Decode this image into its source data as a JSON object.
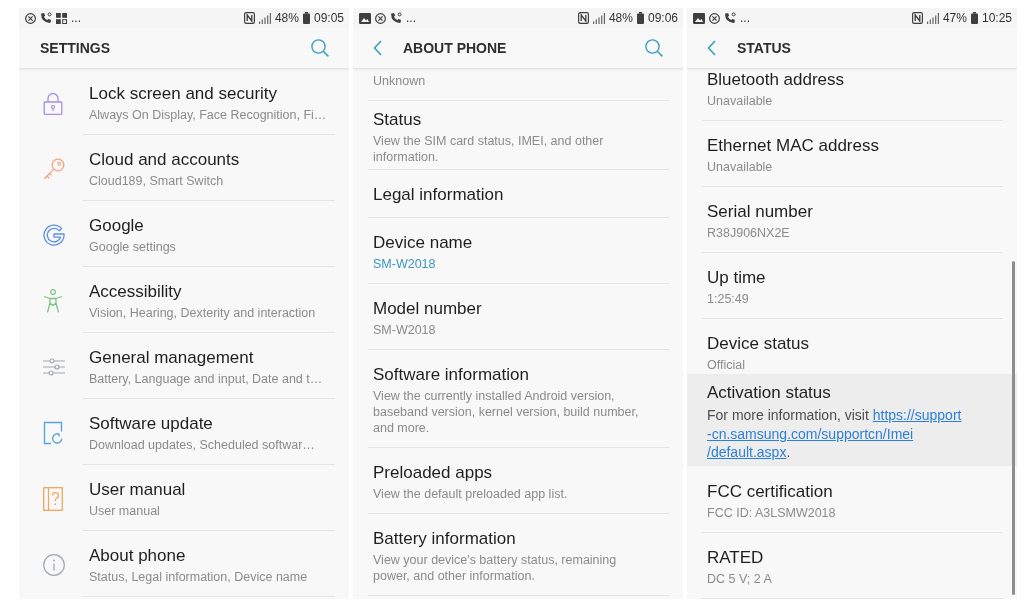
{
  "screens": [
    {
      "kind": "menu",
      "status_bar": {
        "overflow": "...",
        "battery": "48%",
        "time": "09:05"
      },
      "app_bar": {
        "title": "SETTINGS",
        "back": false,
        "search": true
      },
      "scrollbar": false,
      "items": [
        {
          "title": "Lock screen and security",
          "subtitle": "Always On Display, Face Recognition, Fi…"
        },
        {
          "title": "Cloud and accounts",
          "subtitle": "Cloud189, Smart Switch"
        },
        {
          "title": "Google",
          "subtitle": "Google settings"
        },
        {
          "title": "Accessibility",
          "subtitle": "Vision, Hearing, Dexterity and interaction"
        },
        {
          "title": "General management",
          "subtitle": "Battery, Language and input, Date and t…"
        },
        {
          "title": "Software update",
          "subtitle": "Download updates, Scheduled softwar…"
        },
        {
          "title": "User manual",
          "subtitle": "User manual"
        },
        {
          "title": "About phone",
          "subtitle": "Status, Legal information, Device name"
        }
      ]
    },
    {
      "kind": "details",
      "status_bar": {
        "overflow": "...",
        "battery": "48%",
        "time": "09:06"
      },
      "app_bar": {
        "title": "ABOUT PHONE",
        "back": true,
        "search": true
      },
      "scrollbar": false,
      "items": [
        {
          "subtitle": "Unknown",
          "accent": false
        },
        {
          "title": "Status",
          "subtitle": "View the SIM card status, IMEI, and other information.",
          "accent": false
        },
        {
          "title": "Legal information"
        },
        {
          "title": "Device name",
          "subtitle": "SM-W2018",
          "accent": true
        },
        {
          "title": "Model number",
          "subtitle": "SM-W2018",
          "accent": false
        },
        {
          "title": "Software information",
          "subtitle": "View the currently installed Android version, baseband version, kernel version, build number, and more.",
          "accent": false
        },
        {
          "title": "Preloaded apps",
          "subtitle": "View the default preloaded app list.",
          "accent": false
        },
        {
          "title": "Battery information",
          "subtitle": "View your device's battery status, remaining power, and other information.",
          "accent": false
        }
      ]
    },
    {
      "kind": "details",
      "status_bar": {
        "overflow": "...",
        "battery": "47%",
        "time": "10:25"
      },
      "app_bar": {
        "title": "STATUS",
        "back": true,
        "search": false
      },
      "scrollbar": true,
      "items": [
        {
          "kind": "value",
          "title": "Bluetooth address",
          "subtitle": "Unavailable",
          "pressed": false
        },
        {
          "kind": "value",
          "title": "Ethernet MAC address",
          "subtitle": "Unavailable",
          "pressed": false
        },
        {
          "kind": "value",
          "title": "Serial number",
          "subtitle": "R38J906NX2E",
          "pressed": false
        },
        {
          "kind": "value",
          "title": "Up time",
          "subtitle": "1:25:49",
          "pressed": false
        },
        {
          "kind": "value",
          "title": "Device status",
          "subtitle": "Official",
          "pressed": false
        },
        {
          "kind": "link",
          "title": "Activation status",
          "lead": "For more information, visit",
          "link_lines": [
            "https://support",
            "-cn.samsung.com/supportcn/Imei",
            "/default.aspx"
          ],
          "tail": ".",
          "pressed": true
        },
        {
          "kind": "value",
          "title": "FCC certification",
          "subtitle": "FCC ID: A3LSMW2018",
          "pressed": false
        },
        {
          "kind": "value",
          "title": "RATED",
          "subtitle": "DC 5 V; 2 A",
          "pressed": false
        }
      ]
    }
  ]
}
